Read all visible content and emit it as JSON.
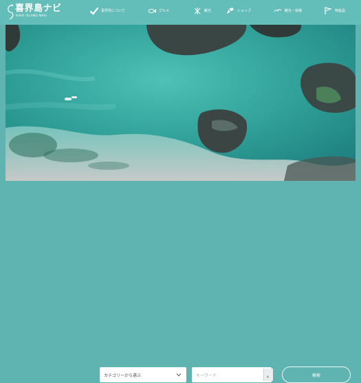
{
  "header": {
    "logo_title": "喜界島ナビ",
    "logo_subtitle": "KIKAI ISLAND NAVI",
    "nav": [
      {
        "label": "喜界島について",
        "icon": "check-icon"
      },
      {
        "label": "グルメ",
        "icon": "fish-icon"
      },
      {
        "label": "観光",
        "icon": "butterfly-icon"
      },
      {
        "label": "ショップ",
        "icon": "pencil-icon"
      },
      {
        "label": "観光・体験",
        "icon": "bird-icon"
      },
      {
        "label": "特産品",
        "icon": "flag-icon"
      }
    ]
  },
  "search": {
    "category_select": "カテゴリーから選ぶ",
    "keyword_placeholder": "キーワード",
    "clear_label": "×",
    "search_button": "検索"
  },
  "colors": {
    "header_bg": "#63bdb8",
    "sea": "#2aa99f"
  }
}
